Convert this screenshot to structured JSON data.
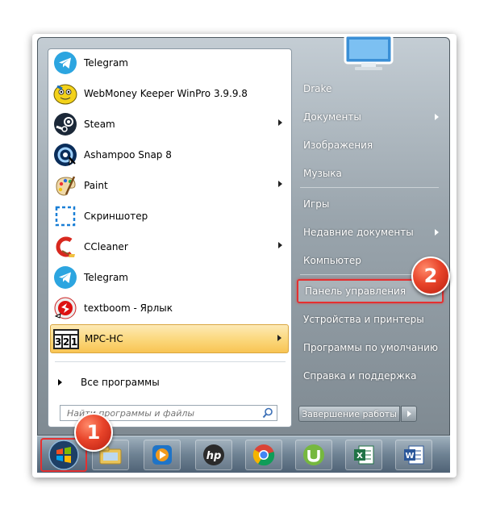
{
  "apps": [
    {
      "label": "Telegram",
      "icon": "telegram-icon",
      "arrow": false,
      "highlight": false
    },
    {
      "label": "WebMoney Keeper WinPro 3.9.9.8",
      "icon": "webmoney-icon",
      "arrow": false,
      "highlight": false
    },
    {
      "label": "Steam",
      "icon": "steam-icon",
      "arrow": true,
      "highlight": false
    },
    {
      "label": "Ashampoo Snap 8",
      "icon": "ashampoo-snap-icon",
      "arrow": false,
      "highlight": false
    },
    {
      "label": "Paint",
      "icon": "paint-icon",
      "arrow": true,
      "highlight": false
    },
    {
      "label": "Скриншотер",
      "icon": "screenshoter-icon",
      "arrow": false,
      "highlight": false
    },
    {
      "label": "CCleaner",
      "icon": "ccleaner-icon",
      "arrow": true,
      "highlight": false
    },
    {
      "label": "Telegram",
      "icon": "telegram-icon",
      "arrow": false,
      "highlight": false
    },
    {
      "label": "textboom - Ярлык",
      "icon": "textboom-icon",
      "arrow": false,
      "highlight": false
    },
    {
      "label": "MPC-HC",
      "icon": "mpc-hc-icon",
      "arrow": true,
      "highlight": true
    }
  ],
  "all_programs": "Все программы",
  "search": {
    "placeholder": "Найти программы и файлы"
  },
  "right_items": [
    {
      "label": "Drake",
      "arrow": false
    },
    {
      "label": "Документы",
      "arrow": true
    },
    {
      "label": "Изображения",
      "arrow": false
    },
    {
      "label": "Музыка",
      "arrow": false
    },
    {
      "label": "Игры",
      "arrow": false
    },
    {
      "label": "Недавние документы",
      "arrow": true
    },
    {
      "label": "Компьютер",
      "arrow": false
    },
    {
      "label": "Панель управления",
      "arrow": false
    },
    {
      "label": "Устройства и принтеры",
      "arrow": false
    },
    {
      "label": "Программы по умолчанию",
      "arrow": false
    },
    {
      "label": "Справка и поддержка",
      "arrow": false
    }
  ],
  "shutdown_label": "Завершение работы",
  "badges": {
    "one": "1",
    "two": "2"
  },
  "taskbar_icons": [
    "explorer-folder-icon",
    "media-player-icon",
    "hp-icon",
    "chrome-icon",
    "utorrent-icon",
    "excel-icon",
    "word-icon"
  ],
  "colors": {
    "highlight": "#e53030",
    "accent_telegram": "#2ca5e0"
  }
}
